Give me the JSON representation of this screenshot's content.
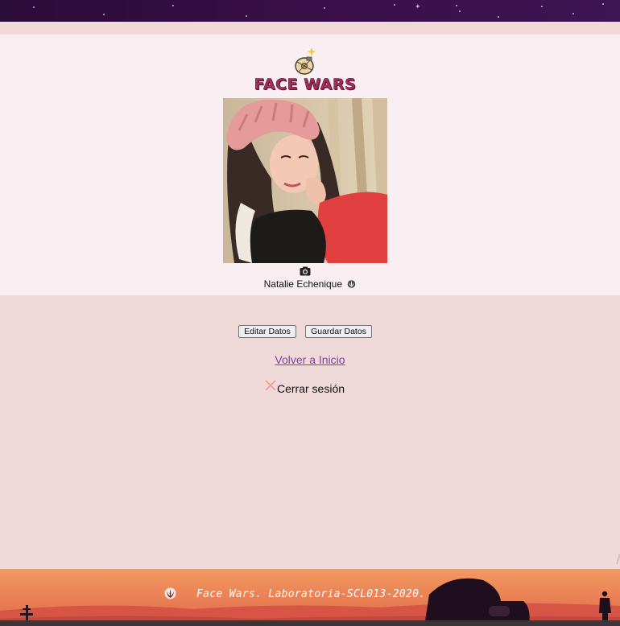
{
  "app": {
    "brand": "FACE WARS"
  },
  "profile": {
    "name": "Natalie Echenique",
    "avatar_alt": "Natalie Echenique",
    "icons": {
      "camera": "camera-icon",
      "badge": "jedi-order-icon"
    }
  },
  "actions": {
    "edit_label": "Editar Datos",
    "save_label": "Guardar Datos",
    "home_link": "Volver a Inicio",
    "logout_label": "Cerrar sesión"
  },
  "footer": {
    "text": "Face Wars. Laboratoria-SCL013-2020."
  },
  "colors": {
    "page_background": "#efd9d9",
    "card_background": "#f9eff2",
    "header_banner": "#2b0b38",
    "brand_text": "#a1305a",
    "link": "#7e3fb0",
    "logout_x": "#ef9a9a",
    "footer_sky": "#eb8356"
  }
}
